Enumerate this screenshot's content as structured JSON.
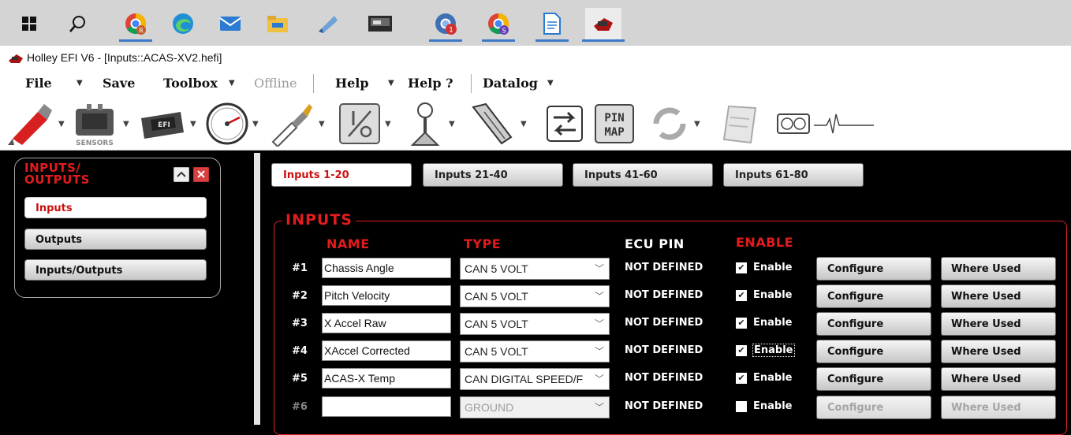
{
  "window": {
    "title": "Holley EFI V6 - [Inputs::ACAS-XV2.hefi]"
  },
  "menubar": {
    "file": "File",
    "save": "Save",
    "toolbox": "Toolbox",
    "offline": "Offline",
    "help": "Help",
    "help_q": "Help ?",
    "datalog": "Datalog"
  },
  "toolbar": {
    "sensors_label": "SENSORS",
    "pin_map": "PIN\nMAP",
    "efi_label": "EFI"
  },
  "side_panel": {
    "title_line1": "INPUTS/",
    "title_line2": "OUTPUTS",
    "items": [
      "Inputs",
      "Outputs",
      "Inputs/Outputs"
    ]
  },
  "tabs": [
    "Inputs 1-20",
    "Inputs 21-40",
    "Inputs 41-60",
    "Inputs 61-80"
  ],
  "section_title": "INPUTS",
  "columns": {
    "name": "NAME",
    "type": "TYPE",
    "ecu_pin": "ECU PIN",
    "enable": "ENABLE"
  },
  "rows": [
    {
      "num": "#1",
      "name": "Chassis Angle",
      "type": "CAN 5 VOLT",
      "ecu_pin": "NOT DEFINED",
      "enable_label": "Enable",
      "enabled": true,
      "configure": "Configure",
      "where_used": "Where Used"
    },
    {
      "num": "#2",
      "name": "Pitch Velocity",
      "type": "CAN 5 VOLT",
      "ecu_pin": "NOT DEFINED",
      "enable_label": "Enable",
      "enabled": true,
      "configure": "Configure",
      "where_used": "Where Used"
    },
    {
      "num": "#3",
      "name": "X Accel Raw",
      "type": "CAN 5 VOLT",
      "ecu_pin": "NOT DEFINED",
      "enable_label": "Enable",
      "enabled": true,
      "configure": "Configure",
      "where_used": "Where Used"
    },
    {
      "num": "#4",
      "name": "XAccel Corrected",
      "type": "CAN 5 VOLT",
      "ecu_pin": "NOT DEFINED",
      "enable_label": "Enable",
      "enabled": true,
      "configure": "Configure",
      "where_used": "Where Used"
    },
    {
      "num": "#5",
      "name": "ACAS-X Temp",
      "type": "CAN DIGITAL SPEED/F",
      "ecu_pin": "NOT DEFINED",
      "enable_label": "Enable",
      "enabled": true,
      "configure": "Configure",
      "where_used": "Where Used"
    },
    {
      "num": "#6",
      "name": "",
      "type": "GROUND",
      "ecu_pin": "NOT DEFINED",
      "enable_label": "Enable",
      "enabled": false,
      "configure": "Configure",
      "where_used": "Where Used"
    }
  ],
  "colors": {
    "accent_red": "#e21c1c",
    "taskbar": "#d4d4d4",
    "panel_bg": "#000000"
  }
}
